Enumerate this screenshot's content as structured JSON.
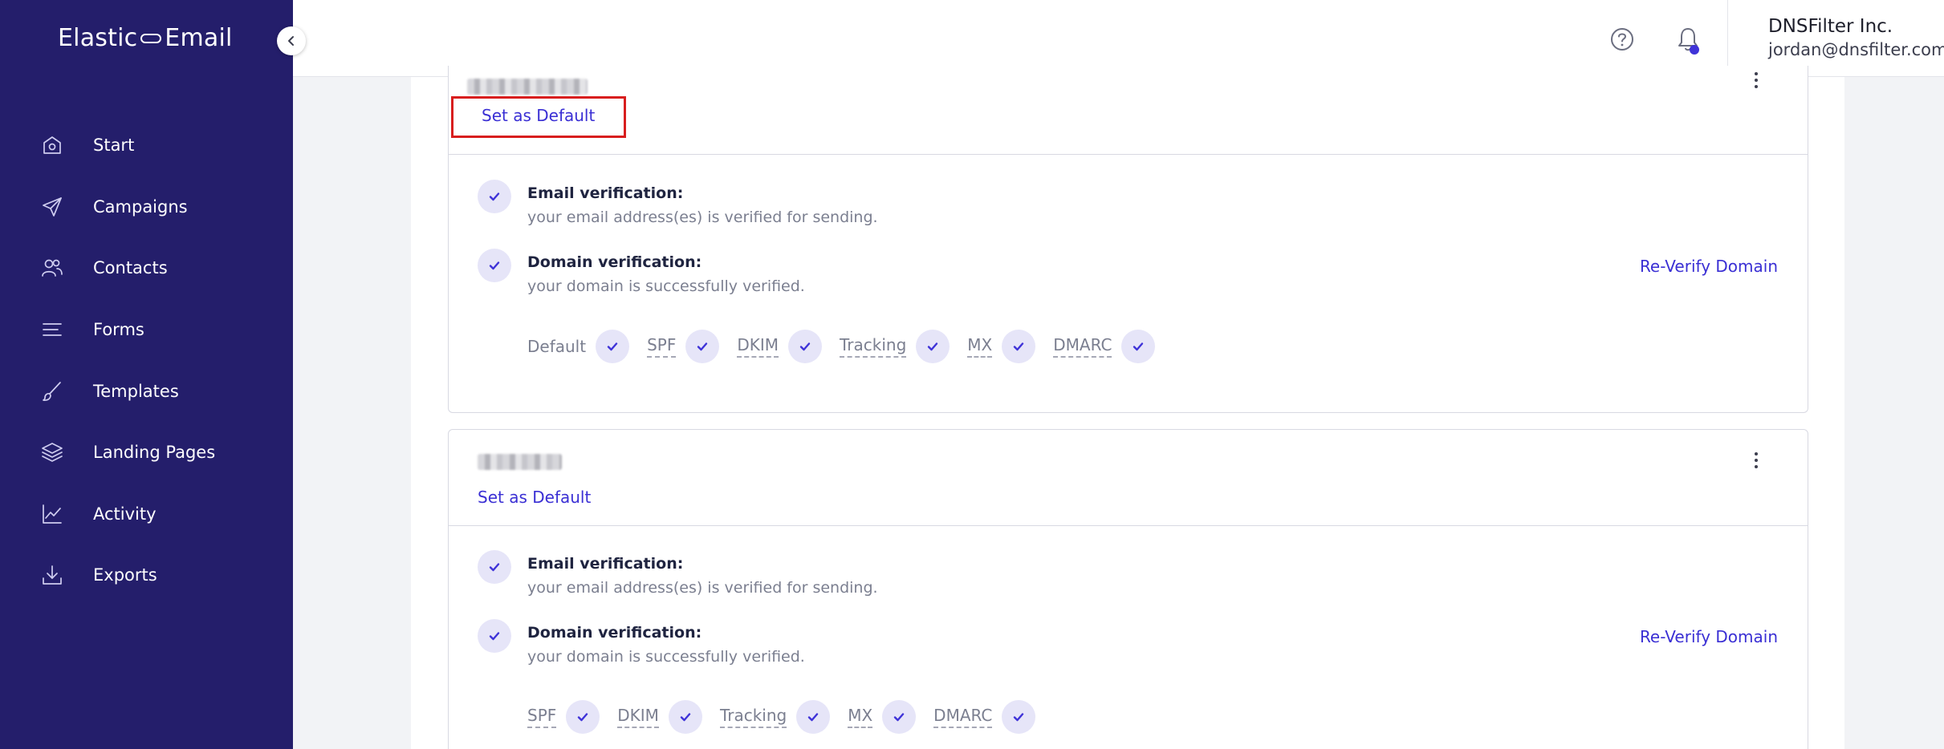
{
  "brand": {
    "left": "Elastic",
    "right": "Email"
  },
  "sidebar": {
    "items": [
      {
        "label": "Start",
        "icon": "home-icon"
      },
      {
        "label": "Campaigns",
        "icon": "send-icon"
      },
      {
        "label": "Contacts",
        "icon": "users-icon"
      },
      {
        "label": "Forms",
        "icon": "lines-icon"
      },
      {
        "label": "Templates",
        "icon": "brush-icon"
      },
      {
        "label": "Landing Pages",
        "icon": "layers-icon"
      },
      {
        "label": "Activity",
        "icon": "chart-icon"
      },
      {
        "label": "Exports",
        "icon": "download-icon"
      }
    ]
  },
  "header": {
    "org_name": "DNSFilter Inc.",
    "user_email": "jordan@dnsfilter.com"
  },
  "domains": [
    {
      "set_default_label": "Set as Default",
      "email_verification_title": "Email verification:",
      "email_verification_text": "your email address(es) is verified for sending.",
      "domain_verification_title": "Domain verification:",
      "domain_verification_text": "your domain is successfully verified.",
      "reverify_label": "Re-Verify Domain",
      "records": [
        "Default",
        "SPF",
        "DKIM",
        "Tracking",
        "MX",
        "DMARC"
      ]
    },
    {
      "set_default_label": "Set as Default",
      "email_verification_title": "Email verification:",
      "email_verification_text": "your email address(es) is verified for sending.",
      "domain_verification_title": "Domain verification:",
      "domain_verification_text": "your domain is successfully verified.",
      "reverify_label": "Re-Verify Domain",
      "records": [
        "SPF",
        "DKIM",
        "Tracking",
        "MX",
        "DMARC"
      ]
    }
  ],
  "colors": {
    "sidebar_bg": "#241e6b",
    "accent": "#3a2fd4",
    "check_bg": "#e6e5f8",
    "highlight": "#d81e1e"
  }
}
